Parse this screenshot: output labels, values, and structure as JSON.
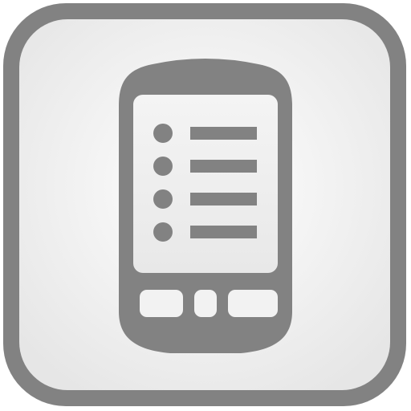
{
  "icon": {
    "name": "phone-list-app-icon",
    "colors": {
      "frame": "#828282",
      "tile_center": "#ffffff",
      "tile_edge": "#e6e6e6",
      "device": "#828282",
      "screen_top": "#f4f4f4",
      "screen_bottom": "#e8e8e8",
      "list_marks": "#828282",
      "buttons": "#f2f2f2"
    },
    "list_rows": 4,
    "hardware_buttons": 3
  }
}
